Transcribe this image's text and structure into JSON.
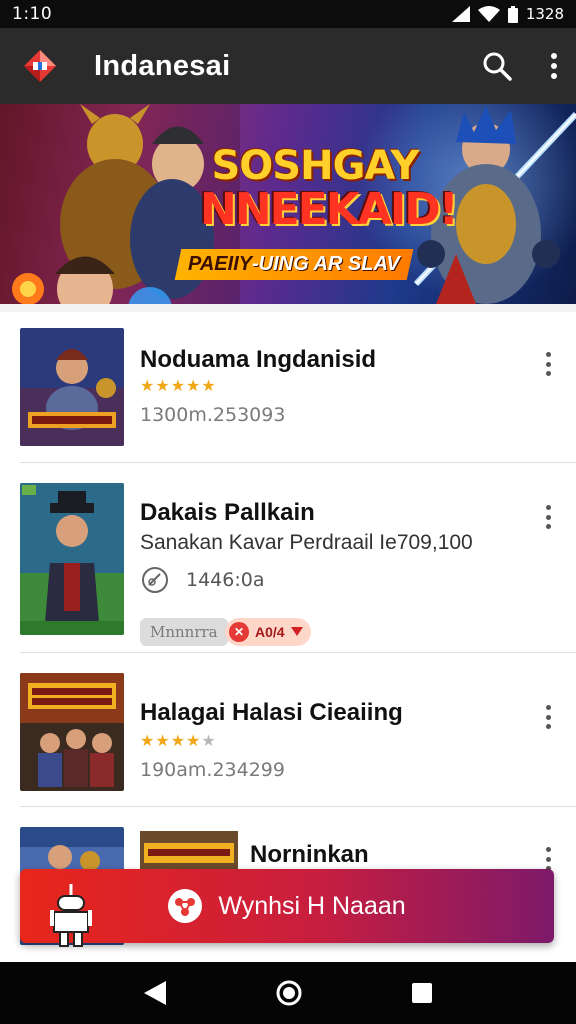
{
  "status_bar": {
    "time": "1:10",
    "right_text": "1328"
  },
  "app_bar": {
    "title": "Indanesai"
  },
  "banner": {
    "headline_top": "SOSHGAY",
    "headline_bottom": "NNEEKAID!",
    "tag_lead": "PAEIIY",
    "tag_rest": "-UING AR SLAV"
  },
  "apps": [
    {
      "name": "Noduama Ingdanisid",
      "meta": "1300m.253093",
      "rating": 5
    },
    {
      "name": "Dakais Pallkain",
      "description": "Sanakan Kavar Perdraail Ie709,100",
      "downloads": "1446:0a",
      "chip_a": "Mnnnrra",
      "chip_b": "A0/4"
    },
    {
      "name": "Halagai Halasi Cieaiing",
      "meta": "190am.234299",
      "rating": 4
    },
    {
      "name": "Norninkan"
    }
  ],
  "cta": {
    "label": "Wynhsi H Naaan"
  },
  "colors": {
    "accent": "#e8261b",
    "app_bar": "#2b2b2b",
    "cta_end": "#7d1a6a"
  }
}
